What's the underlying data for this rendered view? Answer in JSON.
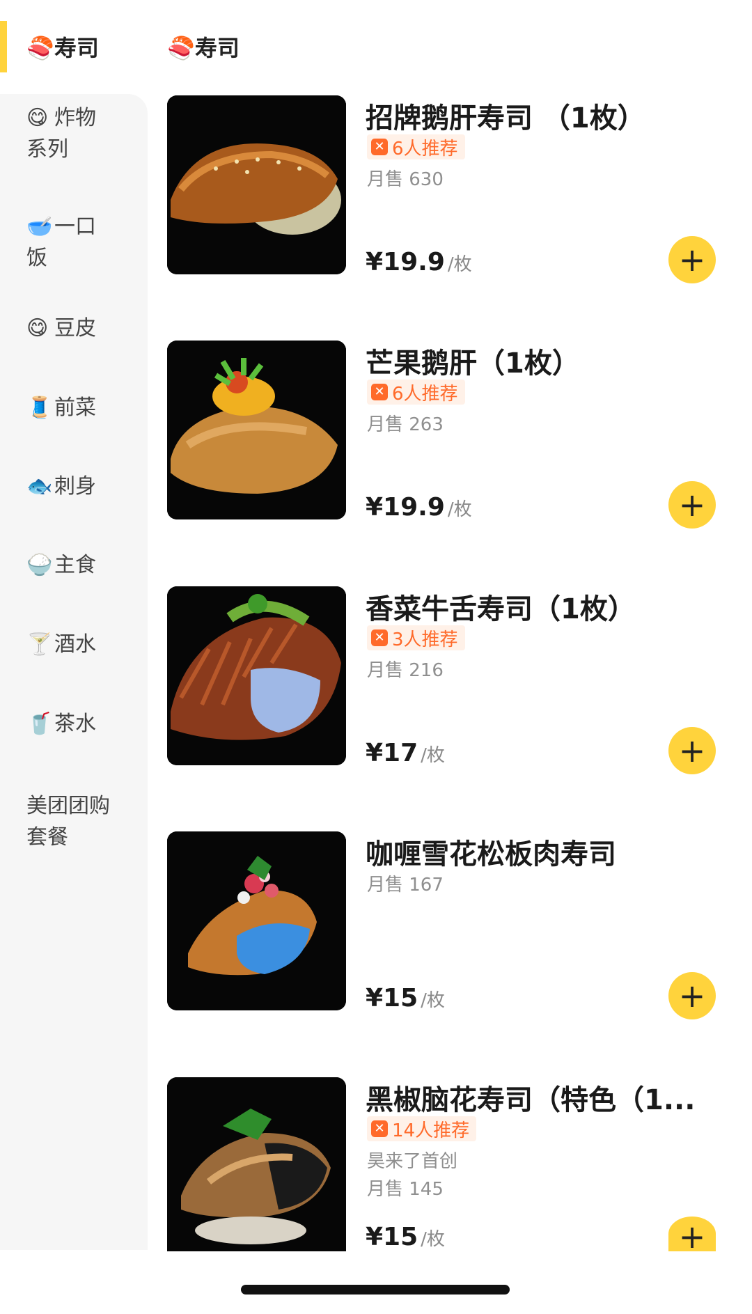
{
  "sidebar": {
    "selected_label": "🍣寿司",
    "items": [
      {
        "emoji": "😋",
        "label_line1": "炸物",
        "label_line2": "系列"
      },
      {
        "emoji": "🥣",
        "label_line1": "一口",
        "label_line2": "饭"
      },
      {
        "emoji": "😋",
        "label_line1": "豆皮",
        "label_line2": ""
      },
      {
        "emoji": "🧵",
        "label_line1": "前菜",
        "label_line2": ""
      },
      {
        "emoji": "🐟",
        "label_line1": "刺身",
        "label_line2": ""
      },
      {
        "emoji": "🍚",
        "label_line1": "主食",
        "label_line2": ""
      },
      {
        "emoji": "🍸",
        "label_line1": "酒水",
        "label_line2": ""
      },
      {
        "emoji": "🥤",
        "label_line1": "茶水",
        "label_line2": ""
      },
      {
        "emoji": "",
        "label_line1": "美团团购",
        "label_line2": "套餐"
      }
    ]
  },
  "section": {
    "title": "🍣寿司"
  },
  "products": [
    {
      "name": "招牌鹅肝寿司 （1枚）",
      "badge": "6人推荐",
      "note": "",
      "sales": "月售 630",
      "price": "¥19.9",
      "unit": "/枚"
    },
    {
      "name": "芒果鹅肝（1枚）",
      "badge": "6人推荐",
      "note": "",
      "sales": "月售 263",
      "price": "¥19.9",
      "unit": "/枚"
    },
    {
      "name": "香菜牛舌寿司（1枚）",
      "badge": "3人推荐",
      "note": "",
      "sales": "月售 216",
      "price": "¥17",
      "unit": "/枚"
    },
    {
      "name": "咖喱雪花松板肉寿司",
      "badge": "",
      "note": "",
      "sales": "月售 167",
      "price": "¥15",
      "unit": "/枚"
    },
    {
      "name": "黑椒脑花寿司（特色（1...",
      "badge": "14人推荐",
      "note": "昊来了首创",
      "sales": "月售 145",
      "price": "¥15",
      "unit": "/枚"
    }
  ],
  "icons": {
    "add": "plus-icon",
    "badge": "recommend-icon"
  },
  "colors": {
    "accent": "#FFD33C",
    "badge_text": "#FF6A2A",
    "badge_bg": "#FFF1E8"
  }
}
